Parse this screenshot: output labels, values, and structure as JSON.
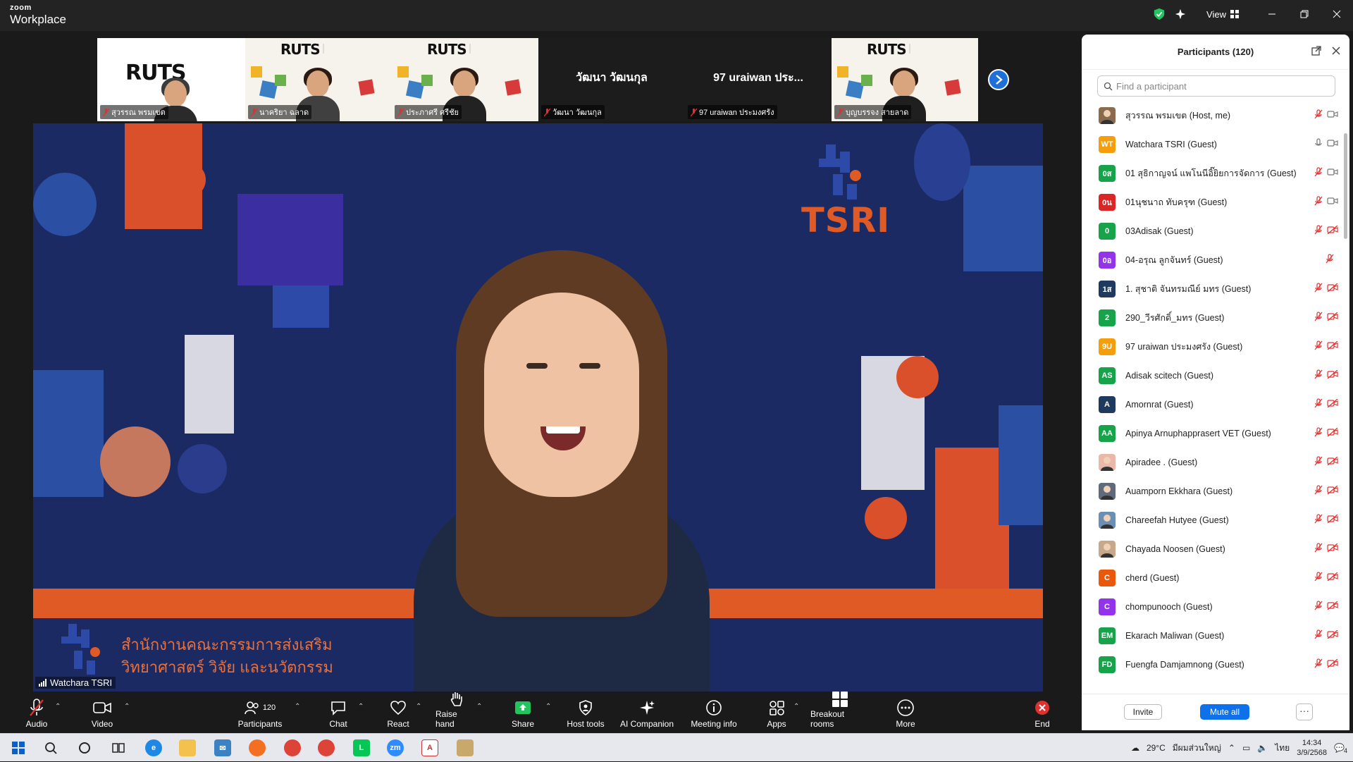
{
  "app": {
    "logo_line1": "zoom",
    "logo_line2": "Workplace",
    "view_label": "View"
  },
  "gallery": {
    "tiles": [
      {
        "name": "สุวรรณ พรมเขต",
        "type": "video",
        "brand": "RUTS"
      },
      {
        "name": "นาคริยา ฉลาด",
        "type": "video",
        "brand": "RUTS"
      },
      {
        "name": "ประภาศรี ศรีชัย",
        "type": "video",
        "brand": "RUTS"
      },
      {
        "name": "วัฒนา วัฒนกุล",
        "type": "name",
        "display": "วัฒนา วัฒนกุล"
      },
      {
        "name": "97 uraiwan ประมงศรัง",
        "type": "name",
        "display": "97 uraiwan ประ..."
      },
      {
        "name": "บุญบรรจง สายลาด",
        "type": "video",
        "brand": "RUTS"
      }
    ]
  },
  "speaker": {
    "name": "Watchara TSRI",
    "logo_text": "TSRI",
    "banner_line1": "สำนักงานคณะกรรมการส่งเสริม",
    "banner_line2": "วิทยาศาสตร์ วิจัย และนวัตกรรม"
  },
  "toolbar": {
    "audio": "Audio",
    "video": "Video",
    "participants": "Participants",
    "participants_count": "120",
    "chat": "Chat",
    "react": "React",
    "raise_hand": "Raise hand",
    "share": "Share",
    "host_tools": "Host tools",
    "ai_companion": "AI Companion",
    "meeting_info": "Meeting info",
    "apps": "Apps",
    "breakout_rooms": "Breakout rooms",
    "more": "More",
    "end": "End"
  },
  "panel": {
    "title": "Participants (120)",
    "search_placeholder": "Find a participant",
    "invite": "Invite",
    "mute_all": "Mute all",
    "more": "···",
    "participants": [
      {
        "name": "สุวรรณ พรมเขต (Host, me)",
        "initials": "",
        "color": "#8a6b4e",
        "photo": true,
        "mic": "muted",
        "cam": "on"
      },
      {
        "name": "Watchara TSRI (Guest)",
        "initials": "WT",
        "color": "#f59e0b",
        "mic": "on",
        "cam": "on"
      },
      {
        "name": "01 สุธิกาญจน์ แพโนนีอิ๊ยิยการจัดการ (Guest)",
        "initials": "0ส",
        "color": "#16a34a",
        "mic": "muted",
        "cam": "on"
      },
      {
        "name": "01นุชนาถ ทับครุฑ (Guest)",
        "initials": "0น",
        "color": "#dc2626",
        "mic": "muted",
        "cam": "on"
      },
      {
        "name": "03Adisak (Guest)",
        "initials": "0",
        "color": "#16a34a",
        "mic": "muted",
        "cam": "off"
      },
      {
        "name": "04-อรุณ ลูกจันทร์ (Guest)",
        "initials": "0อ",
        "color": "#9333ea",
        "mic": "muted",
        "cam": "none"
      },
      {
        "name": "1. สุชาติ จันทรมณีย์ มทร (Guest)",
        "initials": "1ส",
        "color": "#1e3a5f",
        "mic": "muted",
        "cam": "off"
      },
      {
        "name": "290_วีรศักดิ์_มทร (Guest)",
        "initials": "2",
        "color": "#16a34a",
        "mic": "muted",
        "cam": "off"
      },
      {
        "name": "97 uraiwan ประมงศรัง (Guest)",
        "initials": "9U",
        "color": "#f59e0b",
        "mic": "muted",
        "cam": "off"
      },
      {
        "name": "Adisak scitech (Guest)",
        "initials": "AS",
        "color": "#16a34a",
        "mic": "muted",
        "cam": "off"
      },
      {
        "name": "Amornrat (Guest)",
        "initials": "A",
        "color": "#1e3a5f",
        "mic": "muted",
        "cam": "off"
      },
      {
        "name": "Apinya Arnuphapprasert VET (Guest)",
        "initials": "AA",
        "color": "#16a34a",
        "mic": "muted",
        "cam": "off"
      },
      {
        "name": "Apiradee . (Guest)",
        "initials": "",
        "color": "#e9b8a9",
        "photo": true,
        "mic": "muted",
        "cam": "off"
      },
      {
        "name": "Auamporn Ekkhara (Guest)",
        "initials": "",
        "color": "#5f6b7a",
        "photo": true,
        "mic": "muted",
        "cam": "off"
      },
      {
        "name": "Chareefah Hutyee (Guest)",
        "initials": "",
        "color": "#6b8fb3",
        "photo": true,
        "mic": "muted",
        "cam": "off"
      },
      {
        "name": "Chayada Noosen (Guest)",
        "initials": "",
        "color": "#c7a88a",
        "photo": true,
        "mic": "muted",
        "cam": "off"
      },
      {
        "name": "cherd (Guest)",
        "initials": "C",
        "color": "#ea580c",
        "mic": "muted",
        "cam": "off"
      },
      {
        "name": "chompunooch (Guest)",
        "initials": "C",
        "color": "#9333ea",
        "mic": "muted",
        "cam": "off"
      },
      {
        "name": "Ekarach Maliwan (Guest)",
        "initials": "EM",
        "color": "#16a34a",
        "mic": "muted",
        "cam": "off"
      },
      {
        "name": "Fuengfa Damjamnong (Guest)",
        "initials": "FD",
        "color": "#16a34a",
        "mic": "muted",
        "cam": "off"
      }
    ]
  },
  "taskbar": {
    "temperature": "29°C",
    "location": "มีผมส่วนใหญ่",
    "language": "ไทย",
    "time": "14:34",
    "date": "3/9/2568",
    "notification_count": "4"
  }
}
